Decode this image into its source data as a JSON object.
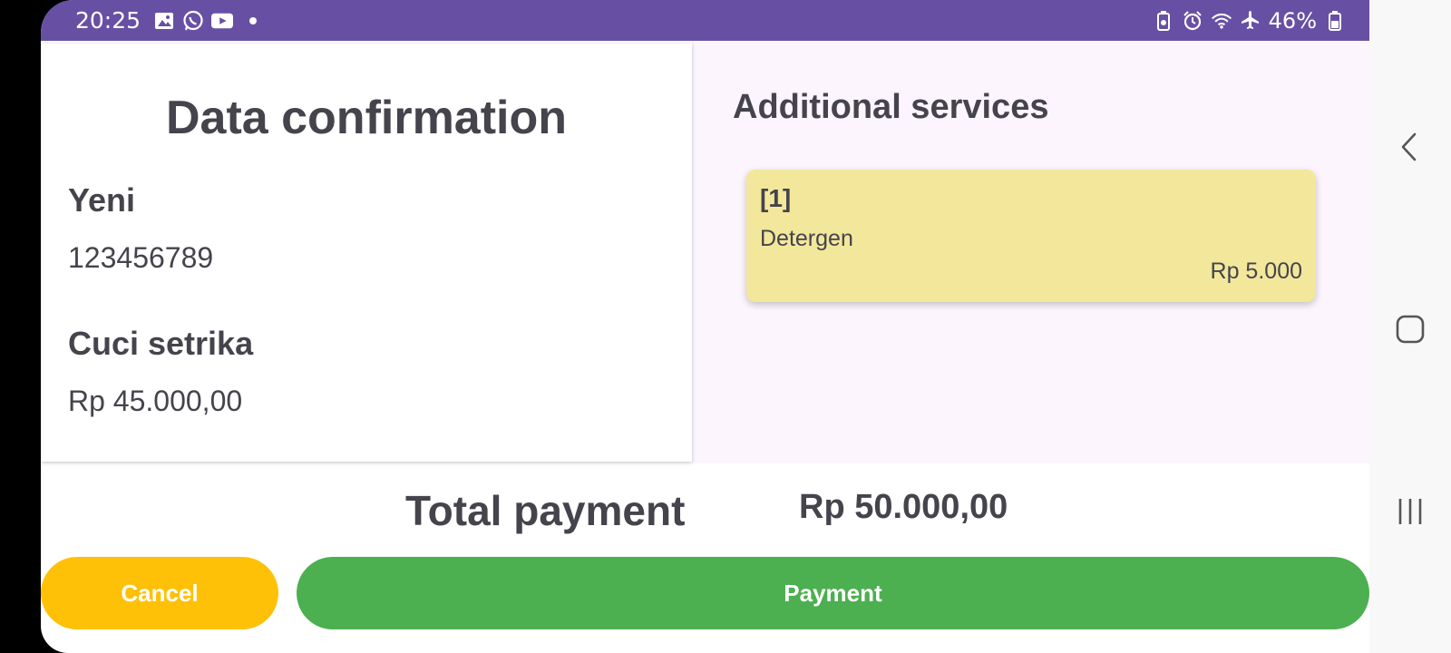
{
  "status_bar": {
    "time": "20:25",
    "battery": "46%",
    "left_icons": [
      "gallery-icon",
      "whatsapp-icon",
      "youtube-icon"
    ],
    "right_icons": [
      "battery-saver-icon",
      "alarm-icon",
      "wifi-icon",
      "airplane-mode-icon"
    ],
    "background_color": "#6750a4"
  },
  "confirmation": {
    "title": "Data confirmation",
    "customer_name": "Yeni",
    "customer_phone": "123456789",
    "service_name": "Cuci setrika",
    "service_price": "Rp 45.000,00"
  },
  "additional": {
    "title": "Additional services",
    "items": [
      {
        "index": "[1]",
        "name": "Detergen",
        "price": "Rp 5.000",
        "color": "#f3e79c"
      }
    ]
  },
  "total": {
    "label": "Total payment",
    "value": "Rp 50.000,00"
  },
  "actions": {
    "cancel_label": "Cancel",
    "cancel_color": "#ffc107",
    "payment_label": "Payment",
    "payment_color": "#4caf50"
  },
  "nav": {
    "icons": [
      "back-icon",
      "home-icon",
      "recents-icon"
    ]
  }
}
